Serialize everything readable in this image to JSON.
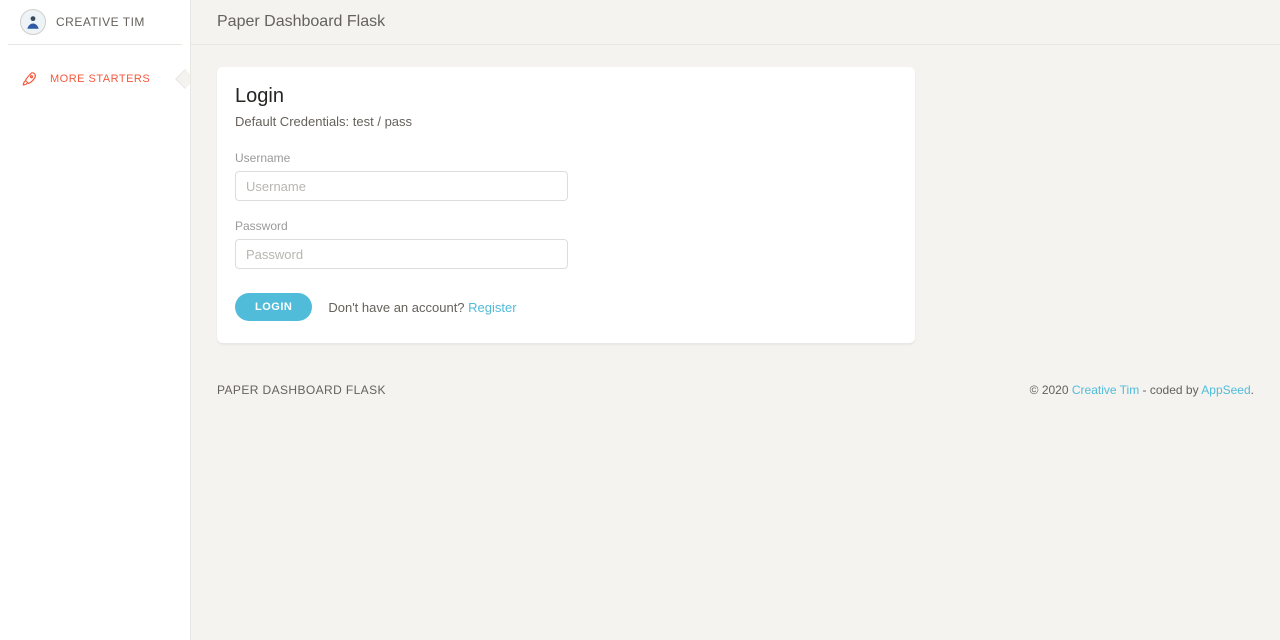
{
  "sidebar": {
    "brand": "CREATIVE TIM",
    "items": [
      {
        "label": "More Starters"
      }
    ]
  },
  "topbar": {
    "title": "Paper Dashboard Flask"
  },
  "login": {
    "title": "Login",
    "subtitle": "Default Credentials: test / pass",
    "username_label": "Username",
    "username_placeholder": "Username",
    "password_label": "Password",
    "password_placeholder": "Password",
    "button": "Login",
    "no_account_text": "Don't have an account? ",
    "register_link": "Register"
  },
  "footer": {
    "left": "Paper Dashboard Flask",
    "copyright_prefix": "© 2020 ",
    "creative_tim": "Creative Tim",
    "coded_by": " - coded by ",
    "appseed": "AppSeed",
    "period": "."
  }
}
